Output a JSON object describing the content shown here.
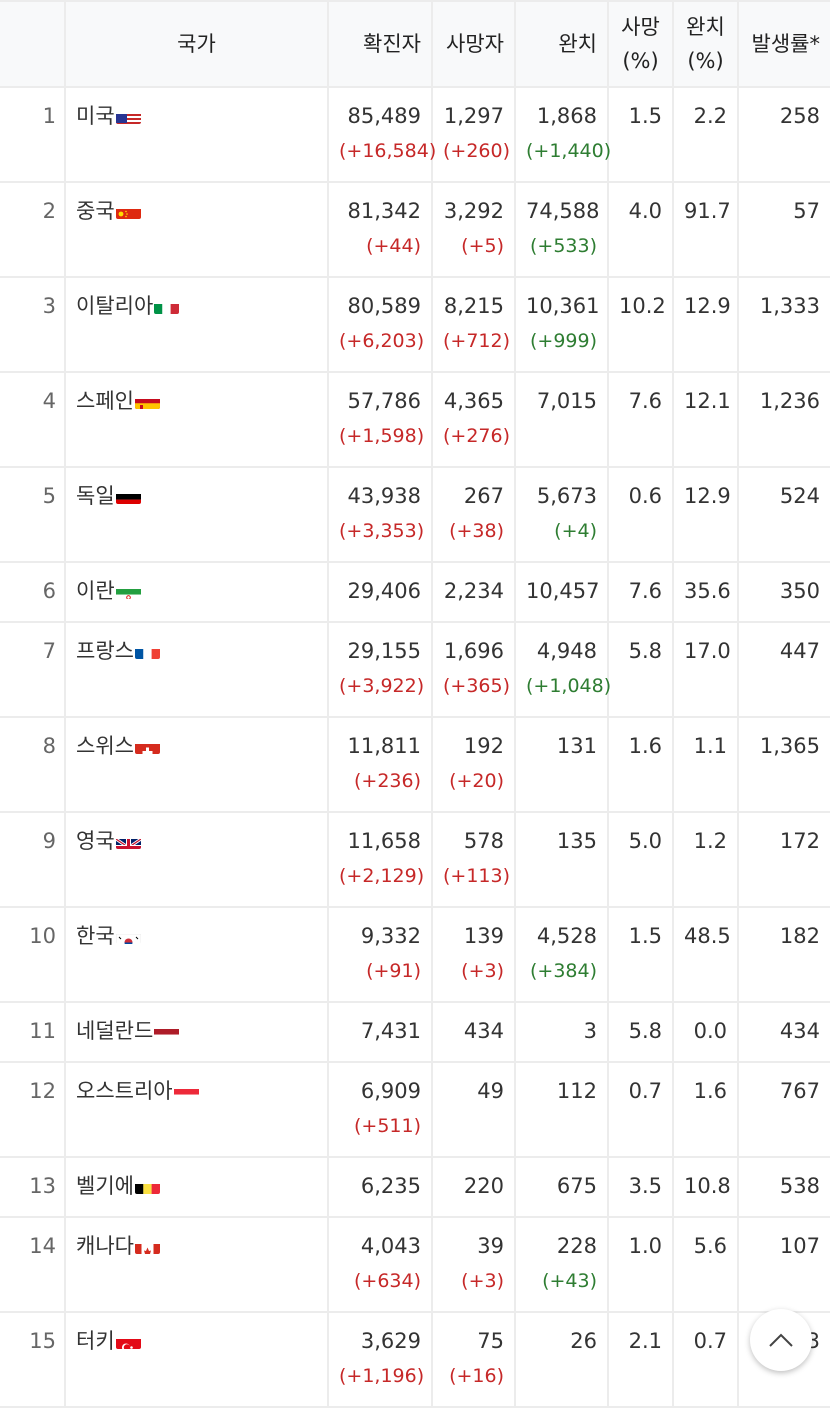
{
  "headers": {
    "country": "국가",
    "confirmed": "확진자",
    "deaths": "사망자",
    "recovered": "완치",
    "death_rate_line1": "사망",
    "death_rate_line2": "(%)",
    "recovery_rate_line1": "완치",
    "recovery_rate_line2": "(%)",
    "incidence": "발생률*"
  },
  "rows": [
    {
      "rank": "1",
      "country": "미국",
      "flag": "us",
      "confirmed": "85,489",
      "confirmed_delta": "(+16,584)",
      "deaths": "1,297",
      "deaths_delta": "(+260)",
      "recovered": "1,868",
      "recovered_delta": "(+1,440)",
      "death_rate": "1.5",
      "recovery_rate": "2.2",
      "incidence": "258"
    },
    {
      "rank": "2",
      "country": "중국",
      "flag": "cn",
      "confirmed": "81,342",
      "confirmed_delta": "(+44)",
      "deaths": "3,292",
      "deaths_delta": "(+5)",
      "recovered": "74,588",
      "recovered_delta": "(+533)",
      "death_rate": "4.0",
      "recovery_rate": "91.7",
      "incidence": "57"
    },
    {
      "rank": "3",
      "country": "이탈리아",
      "flag": "it",
      "confirmed": "80,589",
      "confirmed_delta": "(+6,203)",
      "deaths": "8,215",
      "deaths_delta": "(+712)",
      "recovered": "10,361",
      "recovered_delta": "(+999)",
      "death_rate": "10.2",
      "recovery_rate": "12.9",
      "incidence": "1,333"
    },
    {
      "rank": "4",
      "country": "스페인",
      "flag": "es",
      "confirmed": "57,786",
      "confirmed_delta": "(+1,598)",
      "deaths": "4,365",
      "deaths_delta": "(+276)",
      "recovered": "7,015",
      "recovered_delta": "",
      "death_rate": "7.6",
      "recovery_rate": "12.1",
      "incidence": "1,236"
    },
    {
      "rank": "5",
      "country": "독일",
      "flag": "de",
      "confirmed": "43,938",
      "confirmed_delta": "(+3,353)",
      "deaths": "267",
      "deaths_delta": "(+38)",
      "recovered": "5,673",
      "recovered_delta": "(+4)",
      "death_rate": "0.6",
      "recovery_rate": "12.9",
      "incidence": "524"
    },
    {
      "rank": "6",
      "country": "이란",
      "flag": "ir",
      "confirmed": "29,406",
      "confirmed_delta": "",
      "deaths": "2,234",
      "deaths_delta": "",
      "recovered": "10,457",
      "recovered_delta": "",
      "death_rate": "7.6",
      "recovery_rate": "35.6",
      "incidence": "350"
    },
    {
      "rank": "7",
      "country": "프랑스",
      "flag": "fr",
      "confirmed": "29,155",
      "confirmed_delta": "(+3,922)",
      "deaths": "1,696",
      "deaths_delta": "(+365)",
      "recovered": "4,948",
      "recovered_delta": "(+1,048)",
      "death_rate": "5.8",
      "recovery_rate": "17.0",
      "incidence": "447"
    },
    {
      "rank": "8",
      "country": "스위스",
      "flag": "ch",
      "confirmed": "11,811",
      "confirmed_delta": "(+236)",
      "deaths": "192",
      "deaths_delta": "(+20)",
      "recovered": "131",
      "recovered_delta": "",
      "death_rate": "1.6",
      "recovery_rate": "1.1",
      "incidence": "1,365"
    },
    {
      "rank": "9",
      "country": "영국",
      "flag": "gb",
      "confirmed": "11,658",
      "confirmed_delta": "(+2,129)",
      "deaths": "578",
      "deaths_delta": "(+113)",
      "recovered": "135",
      "recovered_delta": "",
      "death_rate": "5.0",
      "recovery_rate": "1.2",
      "incidence": "172"
    },
    {
      "rank": "10",
      "country": "한국",
      "flag": "kr",
      "confirmed": "9,332",
      "confirmed_delta": "(+91)",
      "deaths": "139",
      "deaths_delta": "(+3)",
      "recovered": "4,528",
      "recovered_delta": "(+384)",
      "death_rate": "1.5",
      "recovery_rate": "48.5",
      "incidence": "182"
    },
    {
      "rank": "11",
      "country": "네덜란드",
      "flag": "nl",
      "confirmed": "7,431",
      "confirmed_delta": "",
      "deaths": "434",
      "deaths_delta": "",
      "recovered": "3",
      "recovered_delta": "",
      "death_rate": "5.8",
      "recovery_rate": "0.0",
      "incidence": "434"
    },
    {
      "rank": "12",
      "country": "오스트리아",
      "flag": "at",
      "confirmed": "6,909",
      "confirmed_delta": "(+511)",
      "deaths": "49",
      "deaths_delta": "",
      "recovered": "112",
      "recovered_delta": "",
      "death_rate": "0.7",
      "recovery_rate": "1.6",
      "incidence": "767"
    },
    {
      "rank": "13",
      "country": "벨기에",
      "flag": "be",
      "confirmed": "6,235",
      "confirmed_delta": "",
      "deaths": "220",
      "deaths_delta": "",
      "recovered": "675",
      "recovered_delta": "",
      "death_rate": "3.5",
      "recovery_rate": "10.8",
      "incidence": "538"
    },
    {
      "rank": "14",
      "country": "캐나다",
      "flag": "ca",
      "confirmed": "4,043",
      "confirmed_delta": "(+634)",
      "deaths": "39",
      "deaths_delta": "(+3)",
      "recovered": "228",
      "recovered_delta": "(+43)",
      "death_rate": "1.0",
      "recovery_rate": "5.6",
      "incidence": "107"
    },
    {
      "rank": "15",
      "country": "터키",
      "flag": "tr",
      "confirmed": "3,629",
      "confirmed_delta": "(+1,196)",
      "deaths": "75",
      "deaths_delta": "(+16)",
      "recovered": "26",
      "recovered_delta": "",
      "death_rate": "2.1",
      "recovery_rate": "0.7",
      "incidence": "3"
    }
  ],
  "colors": {
    "increase": "#c62828",
    "recovered_increase": "#2e7d32",
    "header_bg": "#f8f9fa",
    "border": "#ececec"
  },
  "icons": {
    "scroll_top": "chevron-up-icon"
  }
}
